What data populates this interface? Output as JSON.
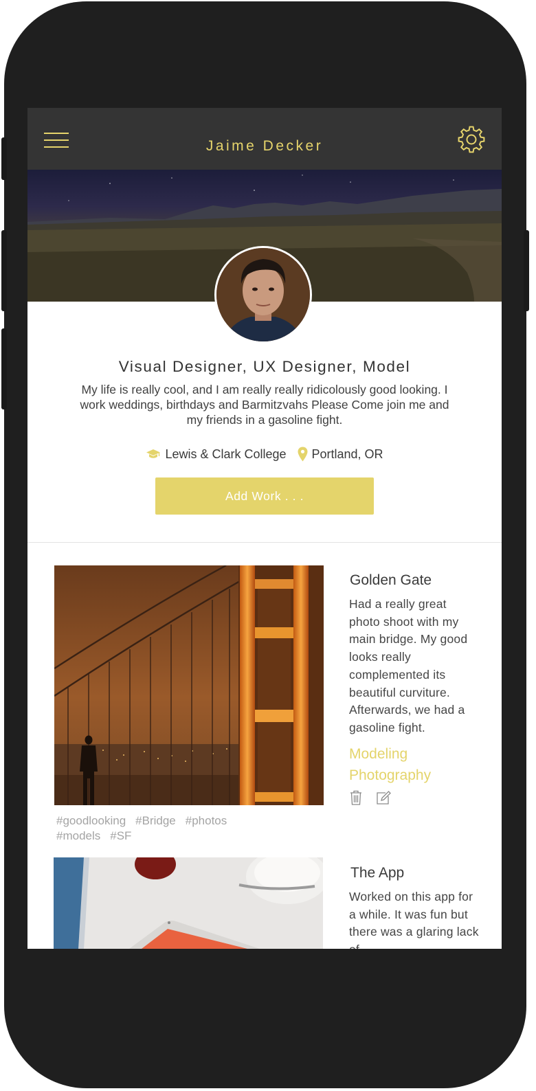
{
  "header": {
    "title": "Jaime Decker",
    "menu_icon": "hamburger-menu-icon",
    "settings_icon": "gear-icon"
  },
  "profile": {
    "headline": "Visual Designer, UX Designer, Model",
    "bio": "My life is really cool, and I am really really ridicolously good looking. I work weddings, birthdays and Barmitzvahs Please Come join me and my friends in a gasoline fight.",
    "school": "Lewis & Clark College",
    "school_icon": "graduation-cap-icon",
    "location": "Portland, OR",
    "location_icon": "map-pin-icon",
    "add_work_label": "Add Work . . ."
  },
  "works": [
    {
      "title": "Golden Gate",
      "description": "Had a really great photo shoot with my main bridge. My good looks really complemented its beautiful curviture. Afterwards, we had a gasoline fight.",
      "category": "Modeling Photography",
      "tags": [
        "#goodlooking",
        "#Bridge",
        "#photos",
        "#models",
        "#SF"
      ]
    },
    {
      "title": "The App",
      "description": "Worked on this app for a while. It was fun but there was a glaring lack of"
    }
  ],
  "colors": {
    "accent": "#e4d46b",
    "topbar": "#343434",
    "phone_frame": "#1f1f1f"
  }
}
